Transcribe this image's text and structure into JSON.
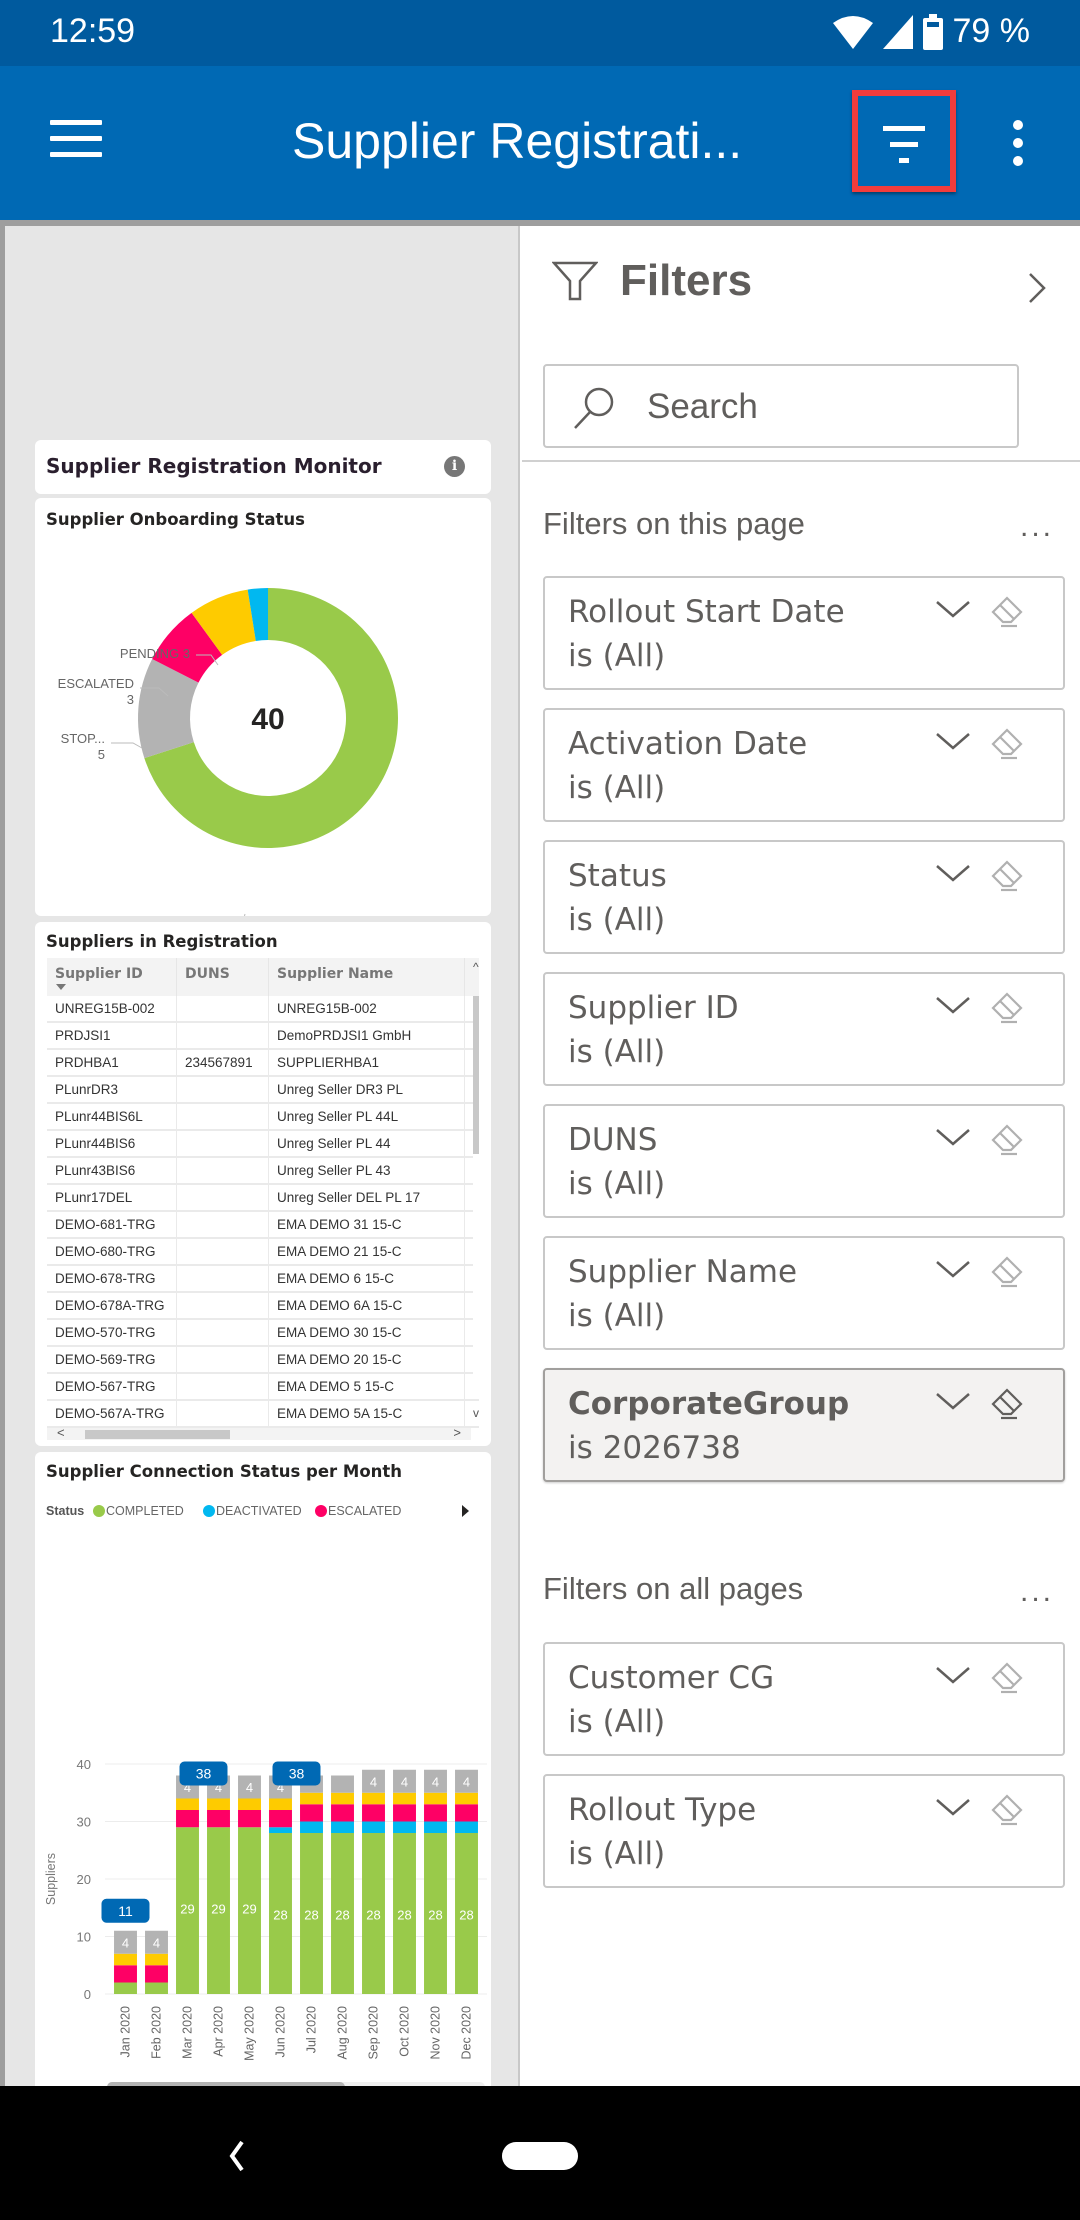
{
  "status_bar": {
    "time": "12:59",
    "battery": "79 %"
  },
  "app_bar": {
    "title": "Supplier Registrati..."
  },
  "report": {
    "monitor_title": "Supplier Registration Monitor",
    "info_glyph": "i",
    "onboarding": {
      "title": "Supplier Onboarding Status",
      "total": "40"
    },
    "table": {
      "title": "Suppliers in Registration",
      "columns": [
        "Supplier ID",
        "DUNS",
        "Supplier Name"
      ],
      "rows": [
        [
          "UNREG15B-002",
          "",
          "UNREG15B-002"
        ],
        [
          "PRDJSI1",
          "",
          "DemoPRDJSI1 GmbH"
        ],
        [
          "PRDHBA1",
          "234567891",
          "SUPPLIERHBA1"
        ],
        [
          "PLunrDR3",
          "",
          "Unreg Seller DR3 PL"
        ],
        [
          "PLunr44BIS6L",
          "",
          "Unreg Seller PL 44L"
        ],
        [
          "PLunr44BIS6",
          "",
          "Unreg Seller PL 44"
        ],
        [
          "PLunr43BIS6",
          "",
          "Unreg Seller PL 43"
        ],
        [
          "PLunr17DEL",
          "",
          "Unreg Seller DEL PL 17"
        ],
        [
          "DEMO-681-TRG",
          "",
          "EMA DEMO 31 15-C"
        ],
        [
          "DEMO-680-TRG",
          "",
          "EMA DEMO 21 15-C"
        ],
        [
          "DEMO-678-TRG",
          "",
          "EMA DEMO 6 15-C"
        ],
        [
          "DEMO-678A-TRG",
          "",
          "EMA DEMO 6A 15-C"
        ],
        [
          "DEMO-570-TRG",
          "",
          "EMA DEMO 30 15-C"
        ],
        [
          "DEMO-569-TRG",
          "",
          "EMA DEMO 20 15-C"
        ],
        [
          "DEMO-567-TRG",
          "",
          "EMA DEMO 5 15-C"
        ],
        [
          "DEMO-567A-TRG",
          "",
          "EMA DEMO 5A 15-C"
        ]
      ],
      "scroll_up": "^",
      "scroll_down": "v",
      "scroll_left": "<",
      "scroll_right": ">"
    },
    "bar_title": "Supplier Connection Status per Month"
  },
  "filters": {
    "title": "Filters",
    "search_placeholder": "Search",
    "page_section": "Filters on this page",
    "all_section": "Filters on all pages",
    "more": "...",
    "page_filters": [
      {
        "name": "Rollout Start Date",
        "value": "is (All)",
        "active": false
      },
      {
        "name": "Activation Date",
        "value": "is (All)",
        "active": false
      },
      {
        "name": "Status",
        "value": "is (All)",
        "active": false
      },
      {
        "name": "Supplier ID",
        "value": "is (All)",
        "active": false
      },
      {
        "name": "DUNS",
        "value": "is (All)",
        "active": false
      },
      {
        "name": "Supplier Name",
        "value": "is (All)",
        "active": false
      },
      {
        "name": "CorporateGroup",
        "value": "is 2026738",
        "active": true
      }
    ],
    "all_filters": [
      {
        "name": "Customer CG",
        "value": "is (All)"
      },
      {
        "name": "Rollout Type",
        "value": "is (All)"
      }
    ]
  },
  "colors": {
    "completed": "#99ca4a",
    "deactivated": "#01b8f0",
    "escalated": "#fe0065",
    "pending": "#fecb00",
    "stopped": "#b3b3b3",
    "total_badge": "#0069b4",
    "app_bar": "#0069b4",
    "status_bar": "#005a9e",
    "highlight": "#f23c3c"
  },
  "chart_data": [
    {
      "type": "pie",
      "title": "Supplier Onboarding Status",
      "center_label": "40",
      "slices": [
        {
          "label": "COMPLETED",
          "value": 28,
          "color": "#99ca4a",
          "show_label": true
        },
        {
          "label": "STOP...",
          "value": 5,
          "color": "#b3b3b3",
          "show_label": true
        },
        {
          "label": "ESCALATED",
          "value": 3,
          "color": "#fe0065",
          "show_label": true
        },
        {
          "label": "PENDING",
          "value": 3,
          "color": "#fecb00",
          "show_label": true
        },
        {
          "label": "DEACTIVATED",
          "value": 1,
          "color": "#01b8f0",
          "show_label": false
        }
      ]
    },
    {
      "type": "bar",
      "stacked": true,
      "title": "Supplier Connection Status per Month",
      "legend_title": "Status",
      "legend": [
        "COMPLETED",
        "DEACTIVATED",
        "ESCALATED"
      ],
      "legend_placement": "top-left",
      "xlabel": "",
      "ylabel": "Suppliers",
      "ylim": [
        0,
        40
      ],
      "yticks": [
        0,
        10,
        20,
        30,
        40
      ],
      "grid": true,
      "categories": [
        "Jan 2020",
        "Feb 2020",
        "Mar 2020",
        "Apr 2020",
        "May 2020",
        "Jun 2020",
        "Jul 2020",
        "Aug 2020",
        "Sep 2020",
        "Oct 2020",
        "Nov 2020",
        "Dec 2020"
      ],
      "series": [
        {
          "name": "COMPLETED",
          "color": "#99ca4a",
          "values": [
            2,
            2,
            29,
            29,
            29,
            28,
            28,
            28,
            28,
            28,
            28,
            28
          ],
          "labels": [
            false,
            false,
            true,
            true,
            true,
            true,
            true,
            true,
            true,
            true,
            true,
            true
          ]
        },
        {
          "name": "DEACTIVATED",
          "color": "#01b8f0",
          "values": [
            0,
            0,
            0,
            0,
            0,
            1,
            2,
            2,
            2,
            2,
            2,
            2
          ],
          "labels": [
            false,
            false,
            false,
            false,
            false,
            false,
            false,
            false,
            false,
            false,
            false,
            false
          ]
        },
        {
          "name": "ESCALATED",
          "color": "#fe0065",
          "values": [
            3,
            3,
            3,
            3,
            3,
            3,
            3,
            3,
            3,
            3,
            3,
            3
          ],
          "labels": [
            false,
            false,
            false,
            false,
            false,
            false,
            false,
            false,
            false,
            false,
            false,
            false
          ]
        },
        {
          "name": "PENDING",
          "color": "#fecb00",
          "values": [
            2,
            2,
            2,
            2,
            2,
            2,
            2,
            2,
            2,
            2,
            2,
            2
          ],
          "labels": [
            false,
            false,
            false,
            false,
            false,
            false,
            false,
            false,
            false,
            false,
            false,
            false
          ]
        },
        {
          "name": "STOPPED",
          "color": "#b3b3b3",
          "values": [
            4,
            4,
            4,
            4,
            4,
            4,
            3,
            3,
            4,
            4,
            4,
            4
          ],
          "labels": [
            true,
            true,
            true,
            true,
            true,
            true,
            false,
            false,
            true,
            true,
            true,
            true
          ]
        }
      ],
      "total_badges": [
        {
          "category": "Jan 2020",
          "value": 11
        },
        {
          "category": "Apr 2020",
          "value": 38
        },
        {
          "category": "Jul 2020",
          "value": 38
        }
      ]
    }
  ]
}
